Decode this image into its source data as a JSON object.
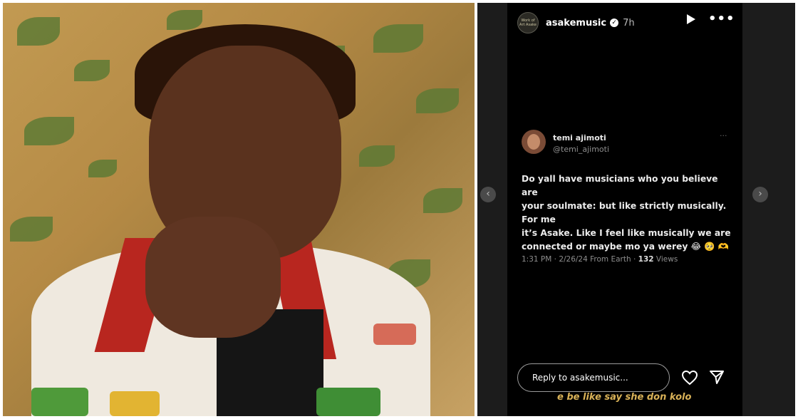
{
  "story": {
    "username": "asakemusic",
    "time": "7h",
    "avatar_text": "Work of Art Asake"
  },
  "tweet": {
    "name": "temi ajimoti",
    "handle": "@temi_ajimoti",
    "body_line1": "Do yall have musicians who you believe are",
    "body_line2": "your soulmate: but like strictly musically.",
    "body_line3": "For me",
    "body_line4": "it’s Asake. Like I feel like musically we are",
    "body_line5": "connected or maybe mo ya werey 😂 🥺 🫶",
    "meta_prefix": "1:31 PM · 2/26/24 From Earth · ",
    "views_count": "132",
    "views_label": " Views"
  },
  "reply": {
    "placeholder": "Reply to asakemusic..."
  },
  "caption": "e be like say she don kolo",
  "icons": {
    "play": "play-icon",
    "more": "more-icon",
    "heart": "heart-icon",
    "send": "send-icon",
    "prev": "chevron-left-icon",
    "next": "chevron-right-icon"
  },
  "colors": {
    "caption": "#d9b258",
    "story_bg": "#000000"
  }
}
